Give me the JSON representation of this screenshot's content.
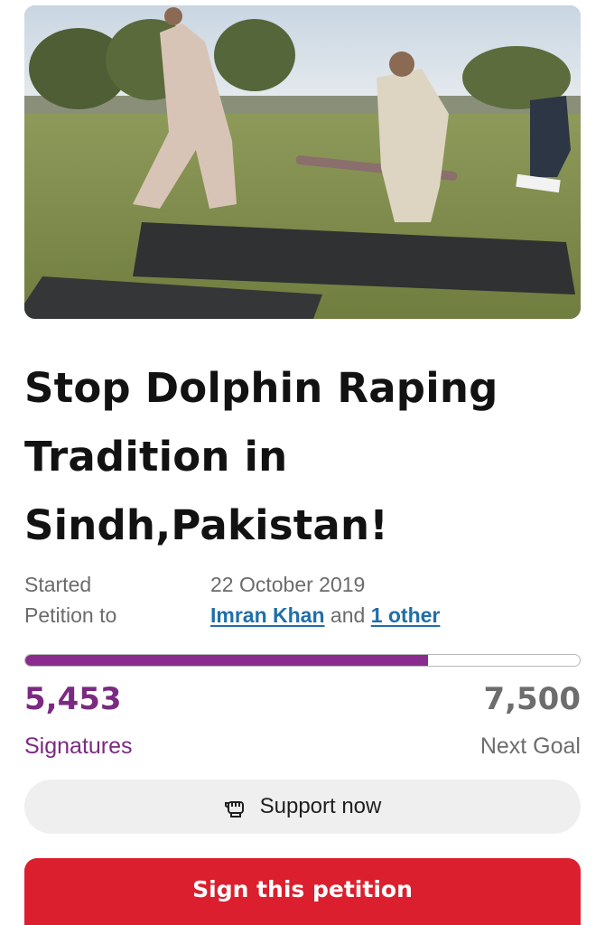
{
  "petition": {
    "title": "Stop Dolphin Raping Tradition in Sindh,Pakistan!",
    "started_label": "Started",
    "started_date": "22 October 2019",
    "petition_to_label": "Petition to",
    "target_primary": "Imran Khan",
    "target_joiner": "and",
    "target_others": "1 other"
  },
  "progress": {
    "signatures_count": "5,453",
    "signatures_label": "Signatures",
    "goal_count": "7,500",
    "goal_label": "Next Goal",
    "fraction": 0.727
  },
  "actions": {
    "support_label": "Support now",
    "support_icon": "raised-fist-icon",
    "sign_label": "Sign this petition"
  },
  "colors": {
    "accent_purple": "#7b2a82",
    "sign_red": "#db1f2e",
    "link_blue": "#1f6fa8"
  }
}
